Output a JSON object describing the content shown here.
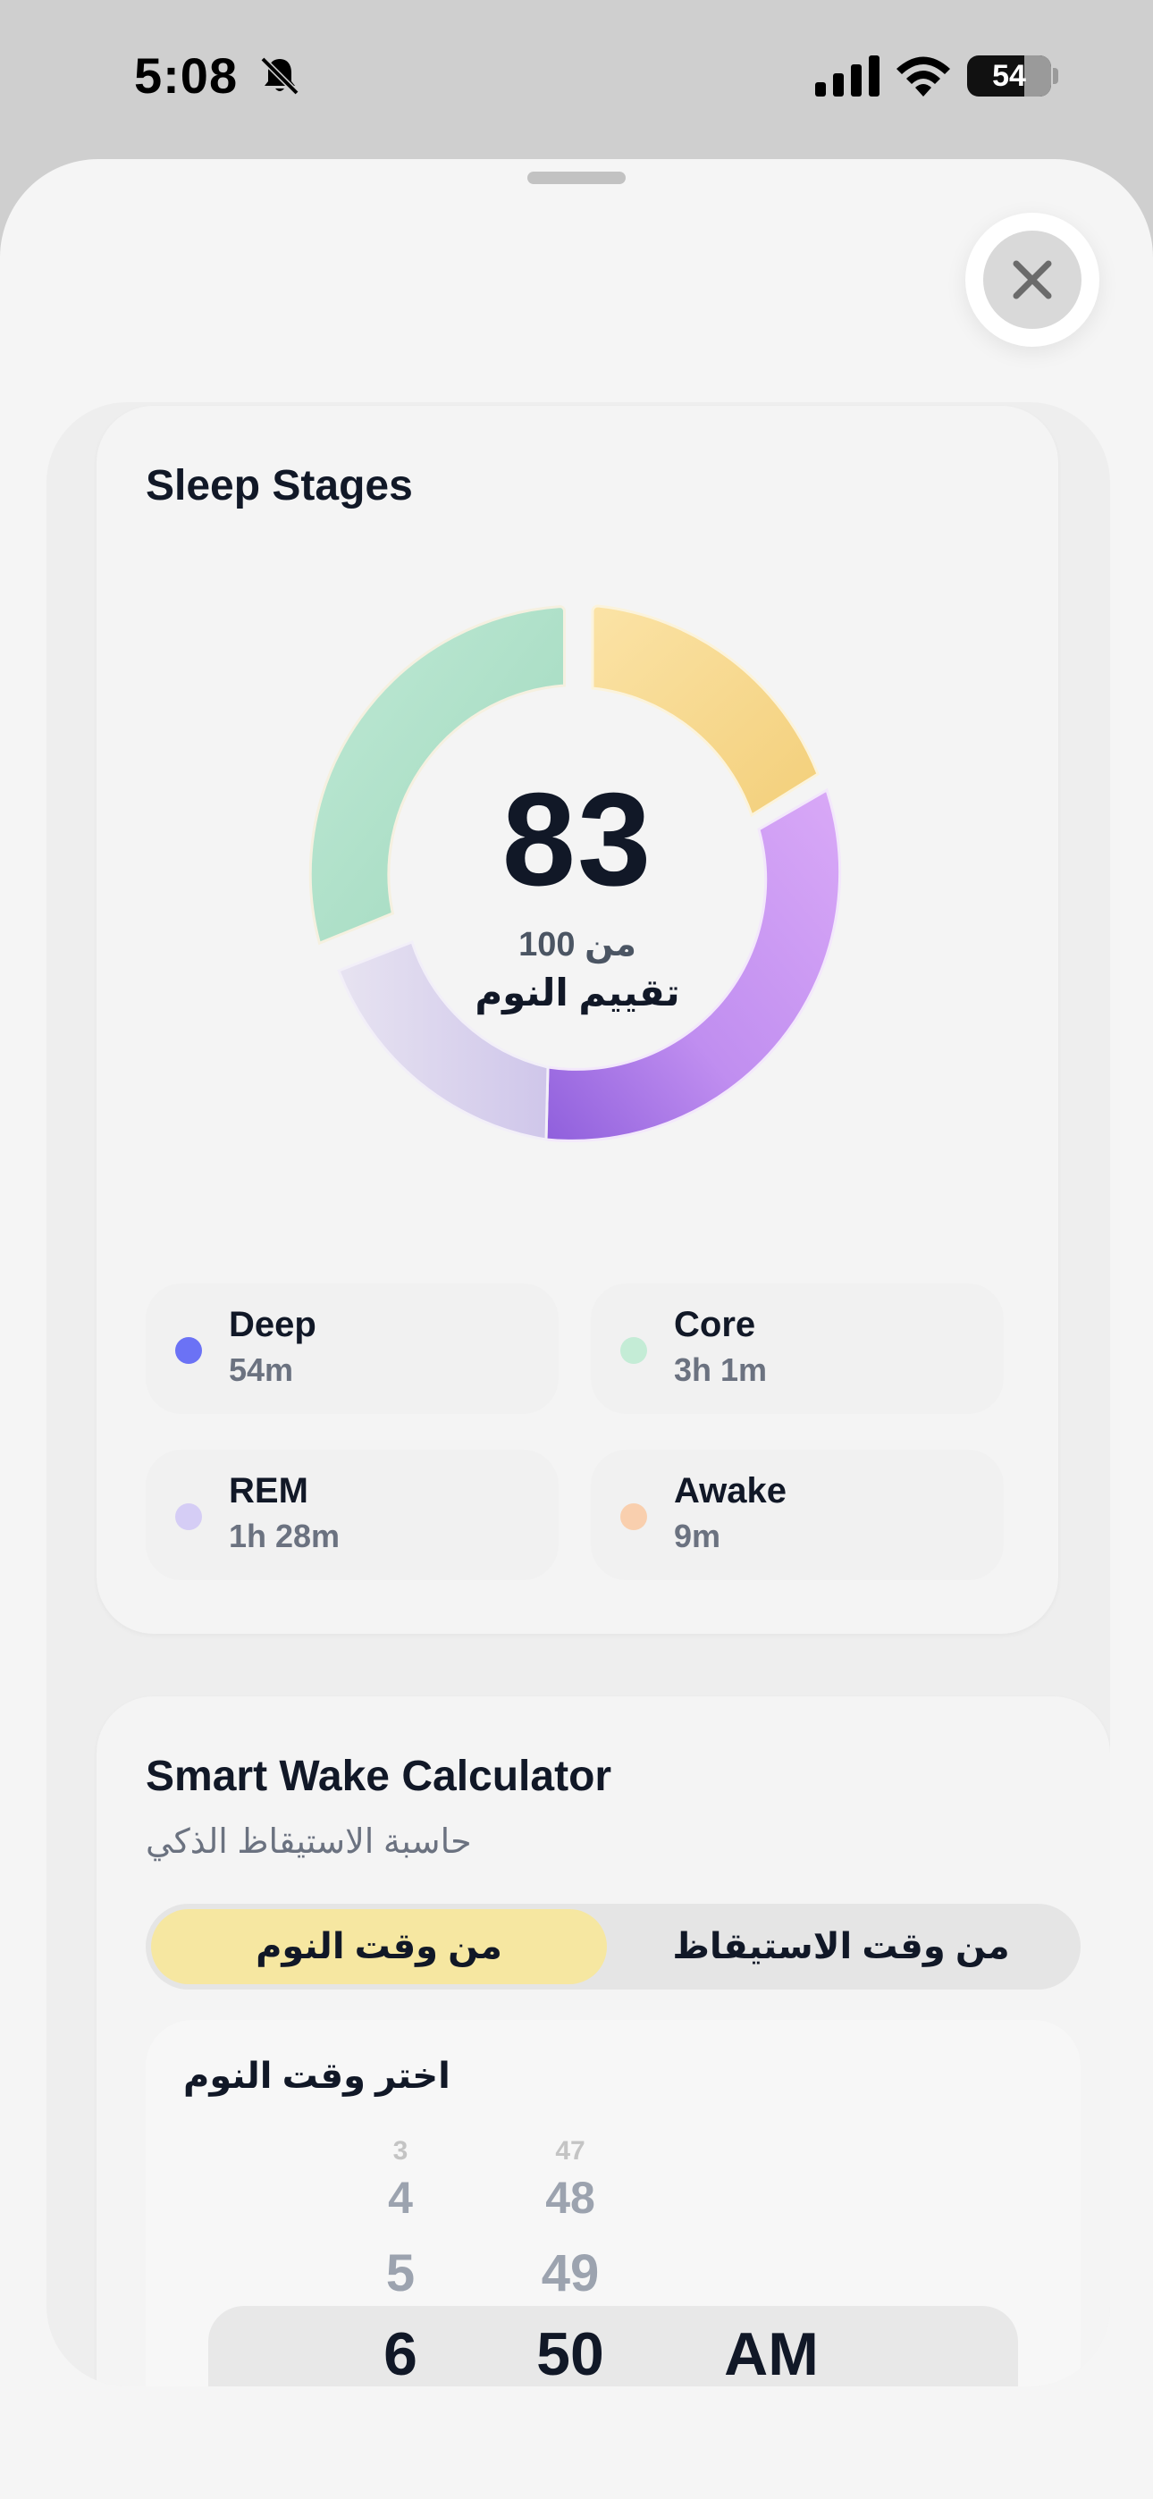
{
  "status_bar": {
    "time": "5:08",
    "battery": "54"
  },
  "sleep_stages": {
    "title": "Sleep Stages",
    "score": "83",
    "score_out_of": "من 100",
    "score_label": "تقييم النوم",
    "legend": [
      {
        "name": "Deep",
        "value": "54m",
        "color": "#6b72f5"
      },
      {
        "name": "Core",
        "value": "3h 1m",
        "color": "#c4ecd6"
      },
      {
        "name": "REM",
        "value": "1h 28m",
        "color": "#d5cdf5"
      },
      {
        "name": "Awake",
        "value": "9m",
        "color": "#f9cfae"
      }
    ],
    "ring_colors": {
      "core": "#b7e4cf",
      "awake": "#f8d88c",
      "rem_bright": "#c99af0",
      "deep": "#9a6ae3",
      "rem_light": "#dcd6ee"
    }
  },
  "smart_wake": {
    "title": "Smart Wake Calculator",
    "subtitle": "حاسبة الاستيقاظ الذكي",
    "tabs": {
      "active": "من وقت النوم",
      "inactive": "من وقت الاستيقاظ"
    },
    "picker": {
      "label": "اختر وقت النوم",
      "hours": [
        "3",
        "4",
        "5",
        "6"
      ],
      "minutes": [
        "47",
        "48",
        "49",
        "50"
      ],
      "period": "AM"
    }
  },
  "colors": {
    "accent_toggle": "#f6e7a1",
    "text_primary": "#111827",
    "text_secondary": "#6b7280"
  },
  "icons": {
    "close": "close-icon",
    "bell": "bell-slash-icon",
    "signal": "cellular-signal-icon",
    "wifi": "wifi-icon"
  }
}
